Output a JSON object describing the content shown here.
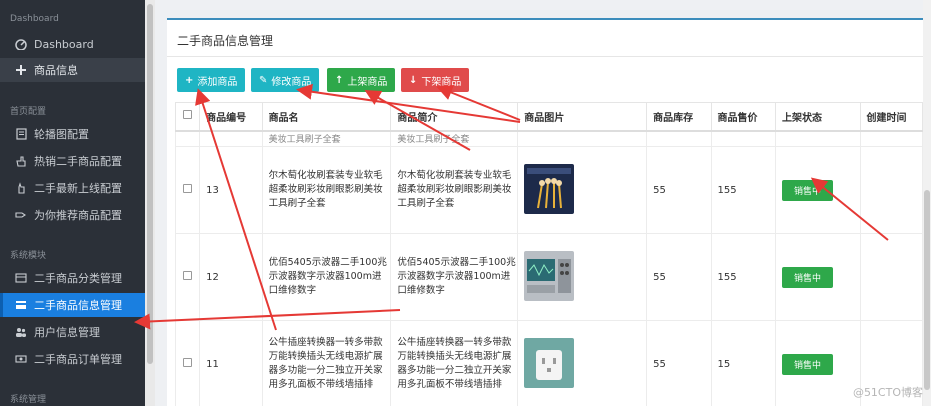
{
  "sidebar": {
    "section_dashboard": "Dashboard",
    "dashboard_label": "Dashboard",
    "goods_info_label": "商品信息",
    "section_home": "首页配置",
    "home_items": [
      "轮播图配置",
      "热销二手商品配置",
      "二手最新上线配置",
      "为你推荐商品配置"
    ],
    "section_modules": "系统模块",
    "module_items": [
      "二手商品分类管理",
      "二手商品信息管理",
      "用户信息管理",
      "二手商品订单管理"
    ],
    "section_system": "系统管理"
  },
  "panel": {
    "title": "二手商品信息管理",
    "buttons": {
      "add": "添加商品",
      "edit": "修改商品",
      "up": "上架商品",
      "down": "下架商品"
    }
  },
  "table": {
    "headers": [
      "商品编号",
      "商品名",
      "商品简介",
      "商品图片",
      "商品库存",
      "商品售价",
      "上架状态",
      "创建时间"
    ],
    "partial_top": {
      "name": "美妆工具刷子全套",
      "intro": "美妆工具刷子全套"
    },
    "rows": [
      {
        "id": "13",
        "name": "尔木萄化妆刷套装专业软毛超柔妆刷彩妆刷眼影刷美妆工具刷子全套",
        "intro": "尔木萄化妆刷套装专业软毛超柔妆刷彩妆刷眼影刷美妆工具刷子全套",
        "stock": "55",
        "price": "155",
        "status": "销售中"
      },
      {
        "id": "12",
        "name": "优佰5405示波器二手100兆示波器数字示波器100m进口维修数字",
        "intro": "优佰5405示波器二手100兆示波器数字示波器100m进口维修数字",
        "stock": "55",
        "price": "155",
        "status": "销售中"
      },
      {
        "id": "11",
        "name": "公牛插座转换器一转多带款万能转换插头无线电源扩展器多功能一分二独立开关家用多孔面板不带线墙插排",
        "intro": "公牛插座转换器一转多带款万能转换插头无线电源扩展器多功能一分二独立开关家用多孔面板不带线墙插排",
        "stock": "55",
        "price": "15",
        "status": "销售中"
      }
    ]
  },
  "watermark": "@51CTO博客",
  "colors": {
    "sidebar_bg": "#2b3038",
    "active": "#1a7fe0",
    "btn_info": "#1fb5c4",
    "btn_success": "#2ea84a",
    "btn_danger": "#e04b4b",
    "arrow": "#e53935"
  }
}
